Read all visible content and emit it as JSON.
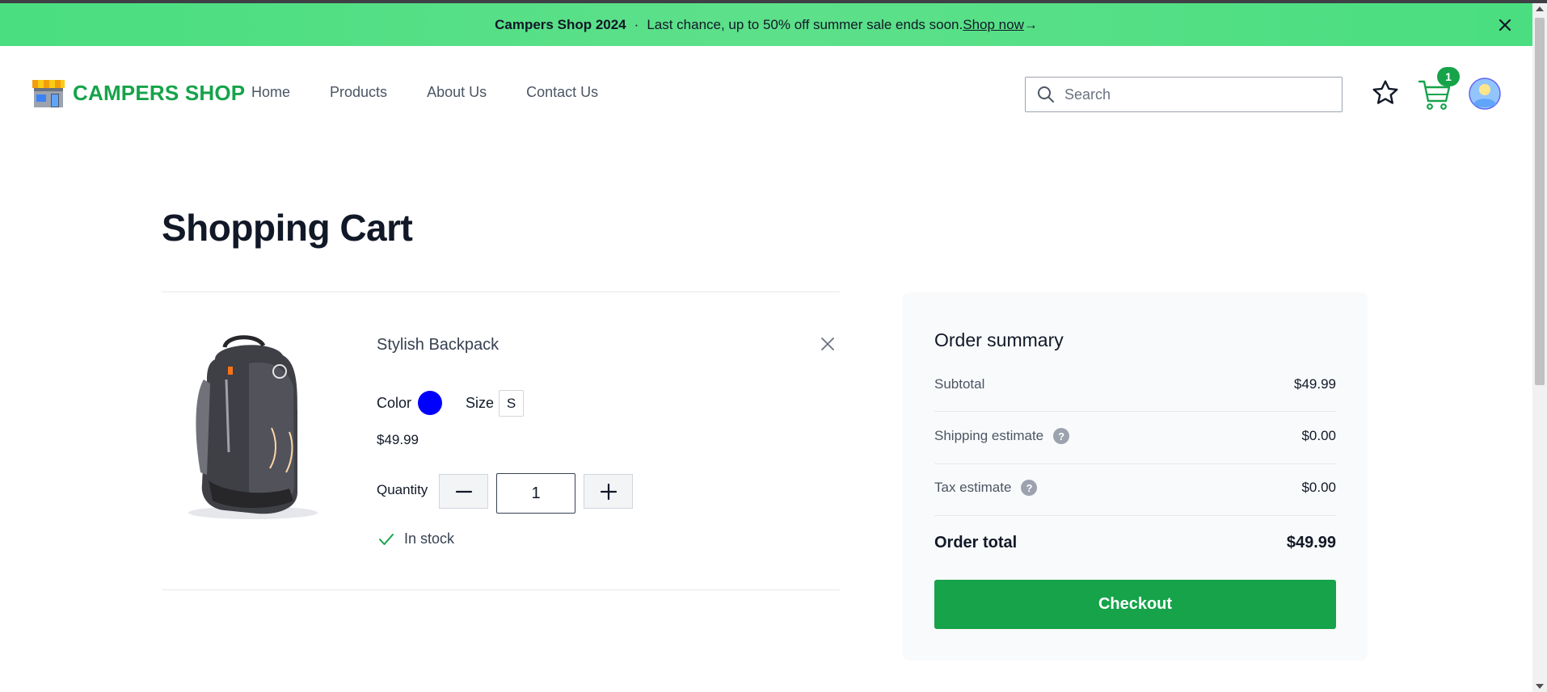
{
  "banner": {
    "brand": "Campers Shop 2024",
    "separator": "·",
    "message": "Last chance, up to 50% off summer sale ends soon.",
    "link_label": " Shop now",
    "arrow": "→"
  },
  "header": {
    "logo_text": "CAMPERS SHOP",
    "nav": [
      "Home",
      "Products",
      "About Us",
      "Contact Us"
    ],
    "search_placeholder": "Search",
    "cart_count": "1"
  },
  "page": {
    "title": "Shopping Cart"
  },
  "cart": {
    "items": [
      {
        "name": "Stylish Backpack",
        "color_label": "Color",
        "color_value": "#0000ff",
        "size_label": "Size",
        "size_value": "S",
        "price": "$49.99",
        "quantity_label": "Quantity",
        "quantity": "1",
        "stock_status": "In stock"
      }
    ]
  },
  "summary": {
    "title": "Order summary",
    "subtotal_label": "Subtotal",
    "subtotal_value": "$49.99",
    "shipping_label": "Shipping estimate",
    "shipping_value": "$0.00",
    "tax_label": "Tax estimate",
    "tax_value": "$0.00",
    "total_label": "Order total",
    "total_value": "$49.99",
    "checkout_label": "Checkout",
    "help_glyph": "?"
  },
  "colors": {
    "brand_green": "#16a34a",
    "banner_green": "#4ade80"
  }
}
